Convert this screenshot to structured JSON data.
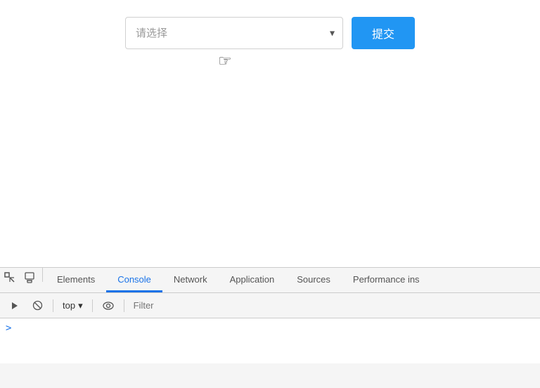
{
  "page": {
    "background": "#ffffff"
  },
  "form": {
    "select_placeholder": "请选择",
    "submit_label": "提交"
  },
  "devtools": {
    "tabs": [
      {
        "id": "elements",
        "label": "Elements",
        "active": false
      },
      {
        "id": "console",
        "label": "Console",
        "active": true
      },
      {
        "id": "network",
        "label": "Network",
        "active": false
      },
      {
        "id": "application",
        "label": "Application",
        "active": false
      },
      {
        "id": "sources",
        "label": "Sources",
        "active": false
      },
      {
        "id": "performance",
        "label": "Performance ins",
        "active": false
      }
    ],
    "console_bar": {
      "context_label": "top",
      "filter_placeholder": "Filter"
    },
    "prompt_symbol": ">"
  },
  "icons": {
    "inspect": "⬚",
    "device": "⬜",
    "run": "▶",
    "clear": "🚫",
    "eye": "👁",
    "chevron_down": "▾"
  }
}
